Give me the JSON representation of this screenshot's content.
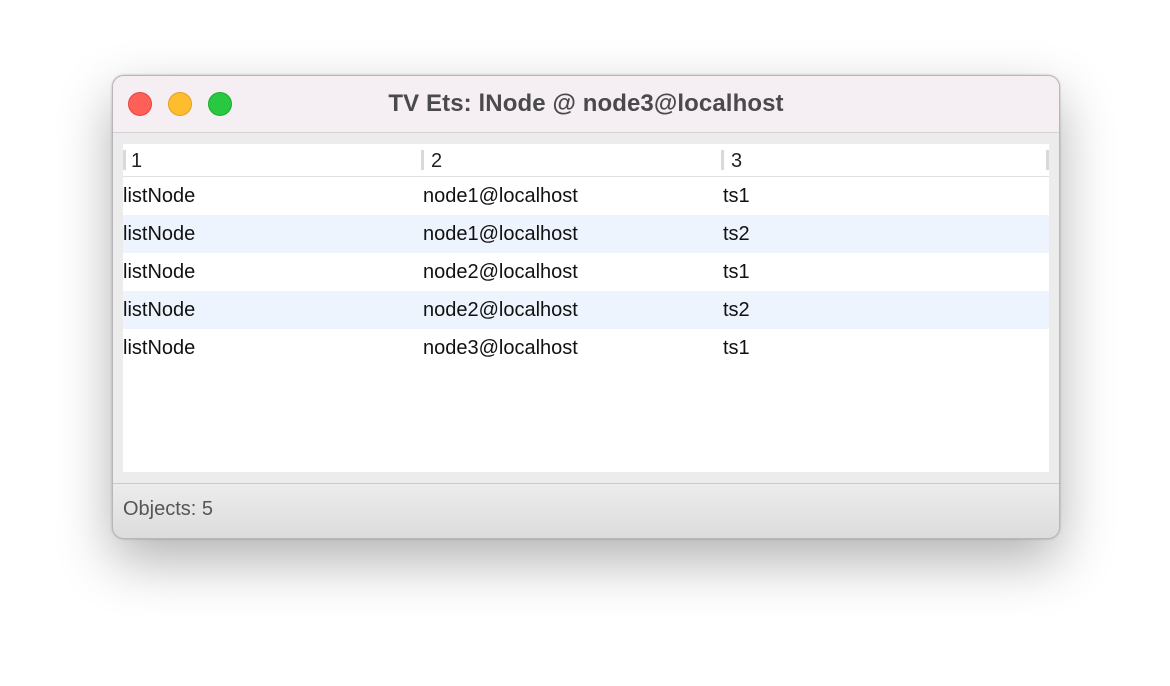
{
  "window": {
    "title": "TV Ets: lNode @ node3@localhost"
  },
  "table": {
    "columns": [
      "1",
      "2",
      "3"
    ],
    "rows": [
      [
        "listNode",
        "node1@localhost",
        "ts1"
      ],
      [
        "listNode",
        "node1@localhost",
        "ts2"
      ],
      [
        "listNode",
        "node2@localhost",
        "ts1"
      ],
      [
        "listNode",
        "node2@localhost",
        "ts2"
      ],
      [
        "listNode",
        "node3@localhost",
        "ts1"
      ]
    ]
  },
  "status": {
    "text": "Objects: 5"
  }
}
